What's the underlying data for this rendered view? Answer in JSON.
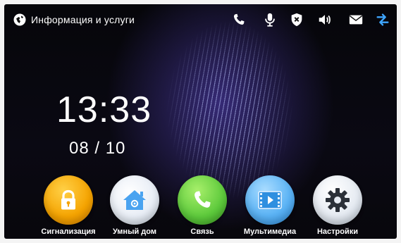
{
  "header": {
    "title": "Информация и услуги",
    "status_icons": [
      "phone-icon",
      "microphone-icon",
      "shield-x-icon",
      "speaker-icon",
      "mail-icon",
      "sync-icon"
    ],
    "sync_color": "#3fa6ff"
  },
  "clock": {
    "time": "13:33",
    "date": "08 / 10"
  },
  "apps": [
    {
      "label": "Сигнализация",
      "icon": "lock-icon",
      "color": "#f5a300"
    },
    {
      "label": "Умный дом",
      "icon": "smart-home-icon",
      "color": "#4aa3f0"
    },
    {
      "label": "Связь",
      "icon": "phone-icon",
      "color": "#5cc93b"
    },
    {
      "label": "Мультимедиа",
      "icon": "multimedia-icon",
      "color": "#2f8fe0"
    },
    {
      "label": "Настройки",
      "icon": "gear-icon",
      "color": "#dfe6ef"
    }
  ]
}
